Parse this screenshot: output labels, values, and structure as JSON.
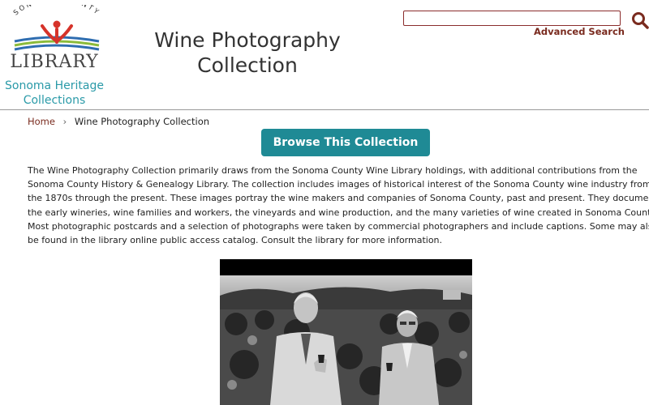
{
  "header": {
    "logo": {
      "arc_text": "SONOMA COUNTY",
      "main_text": "LIBRARY",
      "sub_line1": "Sonoma Heritage",
      "sub_line2": "Collections"
    },
    "title_line1": "Wine Photography",
    "title_line2": "Collection",
    "search": {
      "value": "",
      "placeholder": "",
      "advanced_label": "Advanced Search",
      "icon": "search-icon"
    }
  },
  "breadcrumb": {
    "home": "Home",
    "separator": "›",
    "current": "Wine Photography Collection"
  },
  "browse_button": "Browse This Collection",
  "description": "The Wine Photography Collection primarily draws from the Sonoma County Wine Library holdings, with additional contributions from the Sonoma County History & Genealogy Library. The collection includes images of historical interest of the Sonoma County wine industry from the 1870s through the present. These images portray the wine makers and companies of Sonoma County, past and present. They document the early wineries, wine families and workers, the vineyards and wine production, and the many varieties of wine created in Sonoma County. Most photographic postcards and a selection of photographs were taken by commercial photographers and include captions. Some may also be found in the library online public access catalog. Consult the library for more information.",
  "colors": {
    "brand_teal": "#1f8a95",
    "link_maroon": "#7a2b1f",
    "logo_teal_text": "#2a9aa8"
  }
}
